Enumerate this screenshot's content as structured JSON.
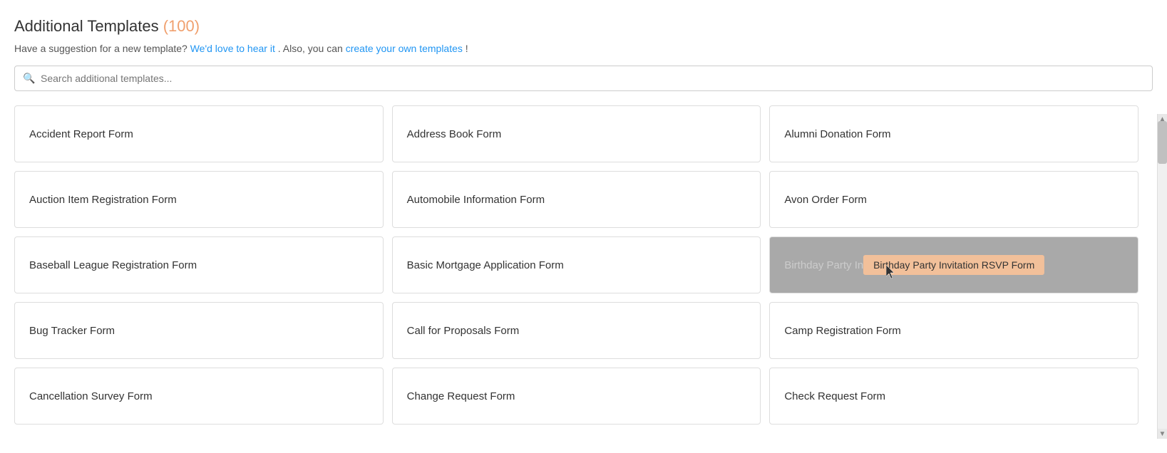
{
  "header": {
    "title": "Additional Templates",
    "count": "(100)",
    "subtitle_text": "Have a suggestion for a new template?",
    "link1_text": "We'd love to hear it",
    "link1_url": "#",
    "subtitle_middle": ". Also, you can",
    "link2_text": "create your own templates",
    "link2_url": "#",
    "subtitle_end": "!"
  },
  "search": {
    "placeholder": "Search additional templates..."
  },
  "grid": {
    "items": [
      {
        "label": "Accident Report Form",
        "highlighted": false
      },
      {
        "label": "Address Book Form",
        "highlighted": false
      },
      {
        "label": "Alumni Donation Form",
        "highlighted": false
      },
      {
        "label": "Auction Item Registration Form",
        "highlighted": false
      },
      {
        "label": "Automobile Information Form",
        "highlighted": false
      },
      {
        "label": "Avon Order Form",
        "highlighted": false
      },
      {
        "label": "Baseball League Registration Form",
        "highlighted": false
      },
      {
        "label": "Basic Mortgage Application Form",
        "highlighted": false
      },
      {
        "label": "Birthday Party Invitation RSVP Form",
        "highlighted": true,
        "tooltip": "Birthday Party Invitation RSVP Form"
      },
      {
        "label": "Bug Tracker Form",
        "highlighted": false
      },
      {
        "label": "Call for Proposals Form",
        "highlighted": false
      },
      {
        "label": "Camp Registration Form",
        "highlighted": false
      },
      {
        "label": "Cancellation Survey Form",
        "highlighted": false
      },
      {
        "label": "Change Request Form",
        "highlighted": false
      },
      {
        "label": "Check Request Form",
        "highlighted": false
      }
    ]
  }
}
